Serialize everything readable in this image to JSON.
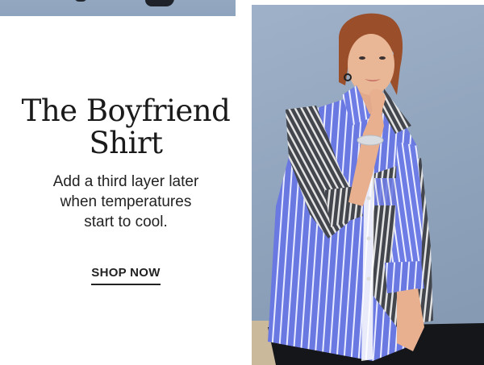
{
  "hero": {
    "headline_line1": "The Boyfriend",
    "headline_line2": "Shirt",
    "subcopy_line1": "Add a third layer later",
    "subcopy_line2": "when temperatures",
    "subcopy_line3": "start to cool.",
    "cta_label": "SHOP NOW"
  },
  "colors": {
    "text": "#1a1a1a",
    "photo_background": "#94a8c0",
    "shirt_blue": "#6c78e0",
    "shirt_stripe_gray": "#4a4a4e"
  }
}
